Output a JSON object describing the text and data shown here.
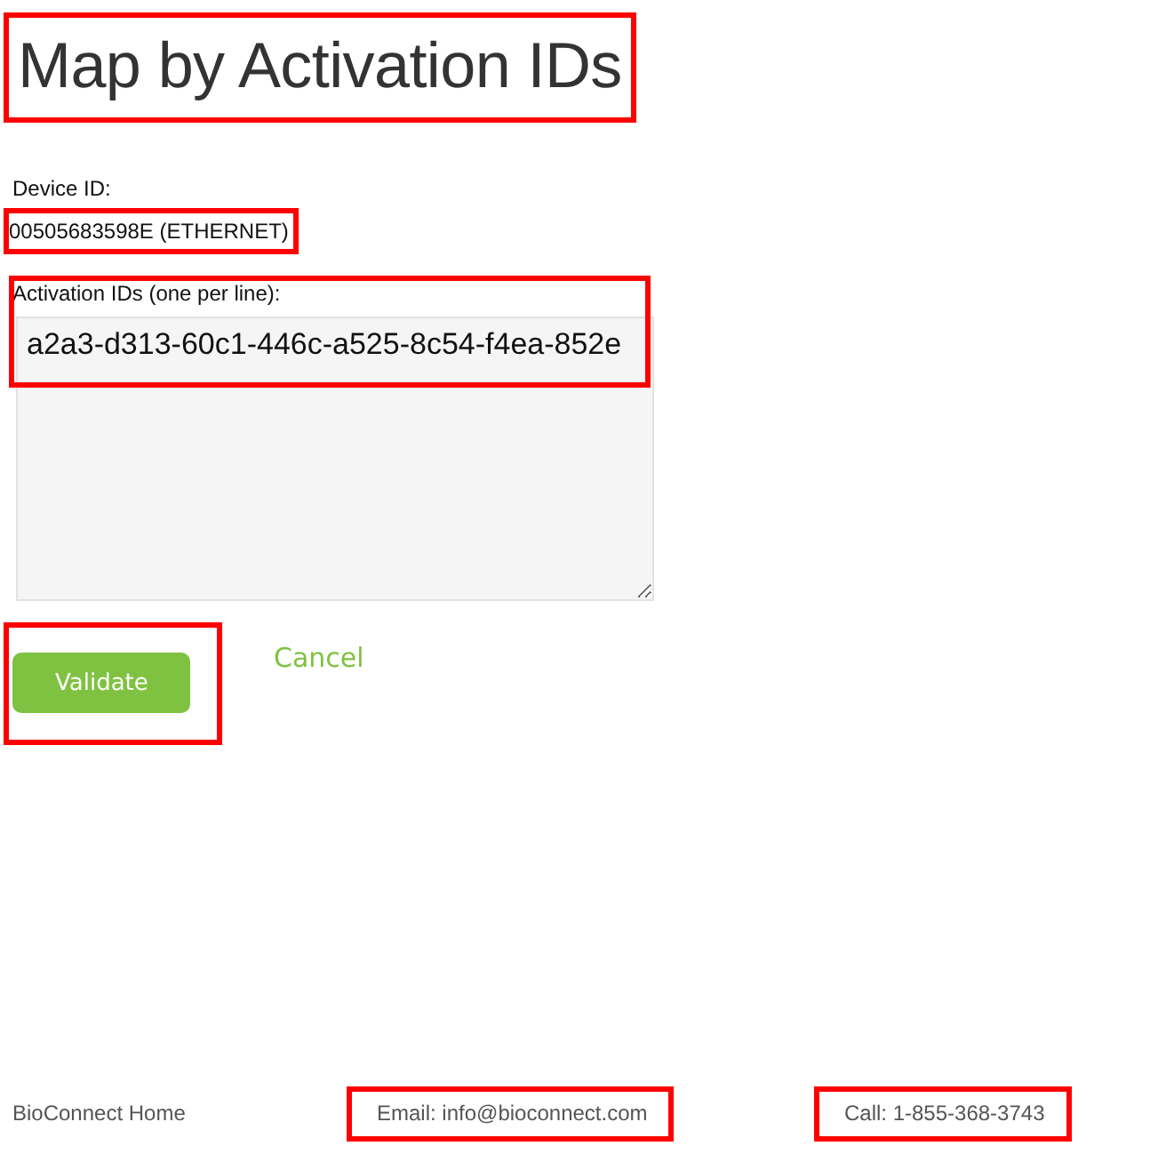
{
  "title": {
    "text": "Map by Activation IDs",
    "highlighted": true
  },
  "device": {
    "label": "Device ID:",
    "value": "00505683598E (ETHERNET)",
    "highlighted": true
  },
  "activation": {
    "label": "Activation IDs (one per line):",
    "value": "a2a3-d313-60c1-446c-a525-8c54-f4ea-852e",
    "highlighted": true
  },
  "buttons": [
    {
      "kind": "primary",
      "label": "Validate",
      "highlighted": true
    },
    {
      "kind": "link",
      "label": "Cancel",
      "highlighted": false
    }
  ],
  "footer": [
    {
      "text": "BioConnect Home",
      "highlighted": false
    },
    {
      "text": "Email: info@bioconnect.com",
      "highlighted": true
    },
    {
      "text": "Call: 1-855-368-3743",
      "highlighted": true
    }
  ]
}
